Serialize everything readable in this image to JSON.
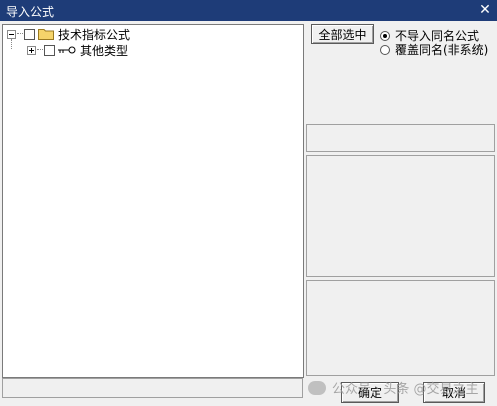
{
  "window": {
    "title": "导入公式",
    "close_icon": "close-icon"
  },
  "tree": {
    "nodes": [
      {
        "label": "技术指标公式",
        "expanded": true,
        "icon": "folder-icon",
        "checked": false
      },
      {
        "label": "其他类型",
        "expanded": false,
        "icon": "key-icon",
        "checked": false
      }
    ]
  },
  "actions": {
    "select_all": "全部选中",
    "ok": "确定",
    "cancel": "取消"
  },
  "options": {
    "no_import_same": "不导入同名公式",
    "overwrite_same": "覆盖同名(非系统)",
    "selected": "no_import_same"
  },
  "watermark": {
    "text": "公众号 · 头条 @交易之主"
  },
  "colors": {
    "titlebar": "#1e3c78",
    "folder": "#f5d46a"
  }
}
